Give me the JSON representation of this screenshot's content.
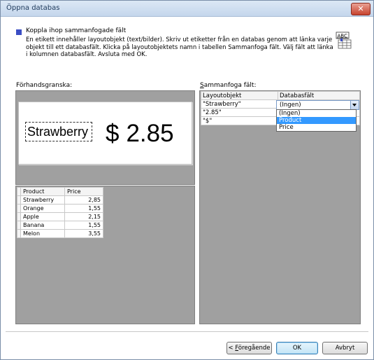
{
  "window": {
    "title": "Öppna databas",
    "close_glyph": "✕"
  },
  "header": {
    "title": "Koppla ihop sammanfogade fält",
    "description": "En etikett innehåller layoutobjekt (text/bilder). Skriv ut etiketter från en databas genom att länka varje\nobjekt till ett databasfält. Klicka på layoutobjektets namn i tabellen Sammanfoga fält. Välj fält att länka\ni kolumnen databasfält. Avsluta med OK.",
    "icon_text": "ABC"
  },
  "preview": {
    "label": "Förhandsgranska:",
    "text_object": "Strawberry",
    "currency": "$",
    "price": "2.85"
  },
  "database": {
    "columns": [
      "Product",
      "Price"
    ],
    "rows": [
      [
        "Strawberry",
        "2,85"
      ],
      [
        "Orange",
        "1,55"
      ],
      [
        "Apple",
        "2,15"
      ],
      [
        "Banana",
        "1,55"
      ],
      [
        "Melon",
        "3,55"
      ]
    ]
  },
  "merge": {
    "label_prefix": "S",
    "label_rest": "ammanfoga fält:",
    "columns": [
      "Layoutobjekt",
      "Databasfält"
    ],
    "rows": [
      {
        "object": "\"Strawberry\"",
        "field": "(Ingen)"
      },
      {
        "object": "\"2.85\"",
        "field": ""
      },
      {
        "object": "\"$\"",
        "field": ""
      }
    ],
    "combo_value": "(Ingen)",
    "dropdown_options": [
      "(Ingen)",
      "Product",
      "Price"
    ],
    "dropdown_selected": "Product"
  },
  "buttons": {
    "prev_lt": "< ",
    "prev_accel": "F",
    "prev_rest": "öregående",
    "ok": "OK",
    "cancel": "Avbryt"
  },
  "colors": {
    "accent": "#3b4ec4",
    "selection": "#3399ff",
    "panel": "#a0a0a0"
  }
}
